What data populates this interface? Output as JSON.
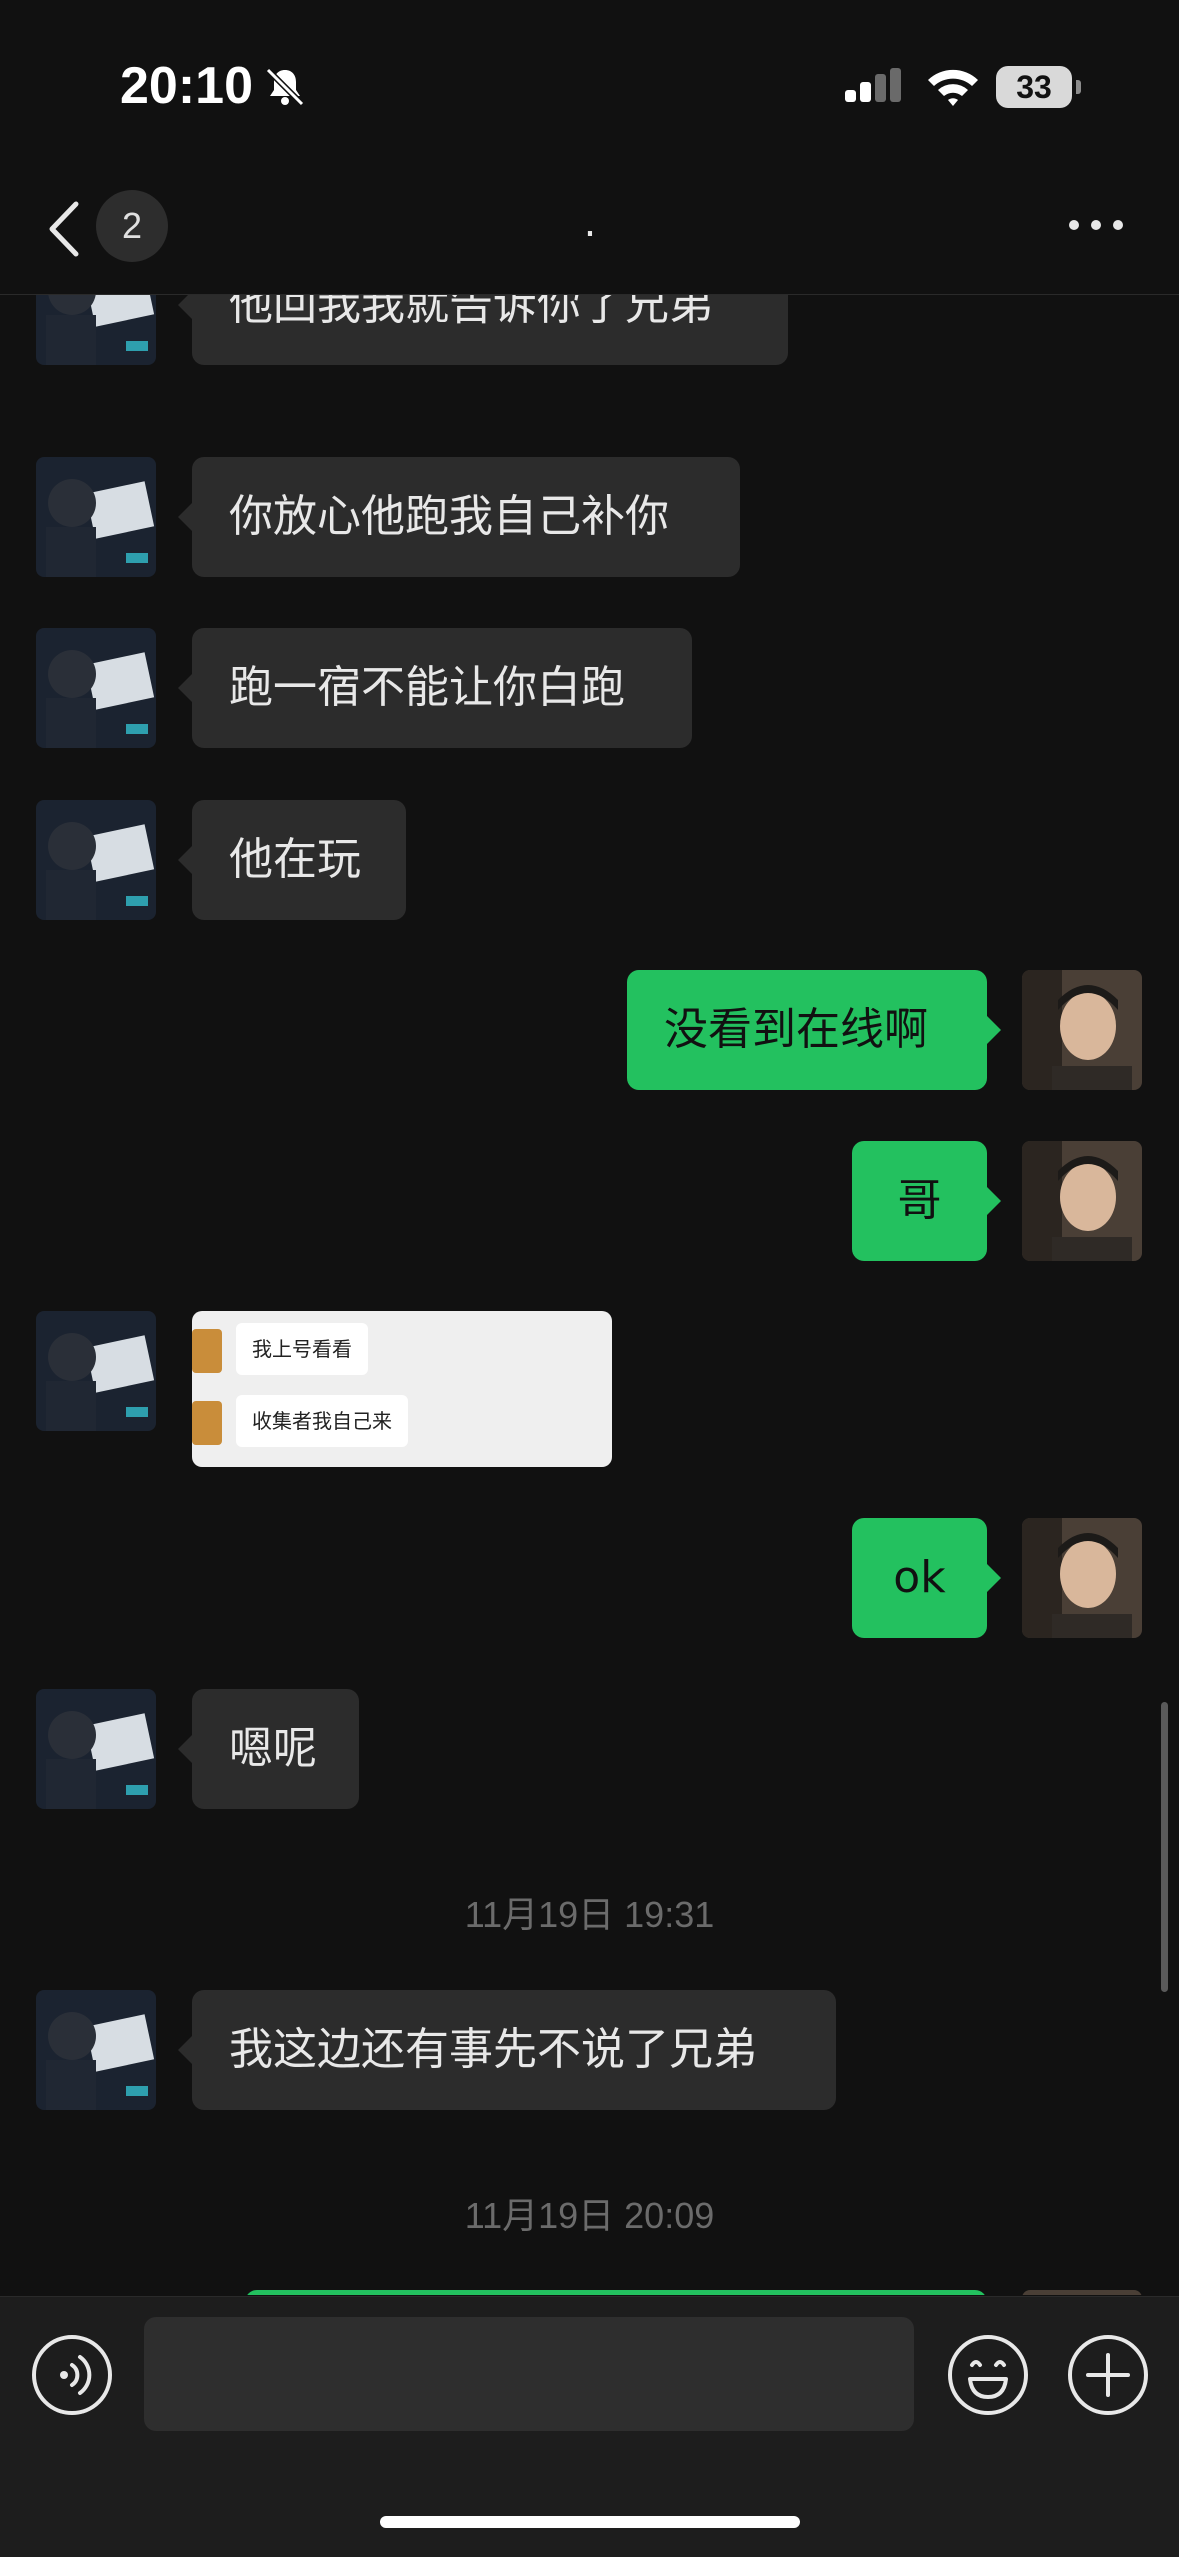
{
  "status_bar": {
    "time": "20:10",
    "battery": "33",
    "icons": [
      "bell-off-icon",
      "signal-icon",
      "wifi-icon",
      "battery-icon"
    ]
  },
  "nav": {
    "unread_count": "2",
    "title": ".",
    "icons": [
      "back-chevron-icon",
      "more-icon"
    ]
  },
  "messages": [
    {
      "side": "in",
      "text": "他回我我就告诉你了兄弟"
    },
    {
      "side": "in",
      "text": "你放心他跑我自己补你"
    },
    {
      "side": "in",
      "text": "跑一宿不能让你白跑"
    },
    {
      "side": "in",
      "text": "他在玩"
    },
    {
      "side": "out",
      "text": "没看到在线啊"
    },
    {
      "side": "out",
      "text": "哥"
    },
    {
      "side": "in",
      "type": "image",
      "image_lines": [
        "我上号看看",
        "收集者我自己来"
      ]
    },
    {
      "side": "out",
      "text": "ok"
    },
    {
      "side": "in",
      "text": "嗯呢"
    },
    {
      "type": "timestamp",
      "text": "11月19日 19:31"
    },
    {
      "side": "in",
      "text": "我这边还有事先不说了兄弟"
    },
    {
      "type": "timestamp",
      "text": "11月19日 20:09"
    }
  ],
  "input_bar": {
    "text_value": "",
    "icons": [
      "voice-icon",
      "emoji-icon",
      "plus-icon"
    ]
  },
  "colors": {
    "background": "#111111",
    "incoming_bubble": "#2c2c2c",
    "outgoing_bubble": "#23c15f",
    "input_bar": "#1d1d1d"
  }
}
